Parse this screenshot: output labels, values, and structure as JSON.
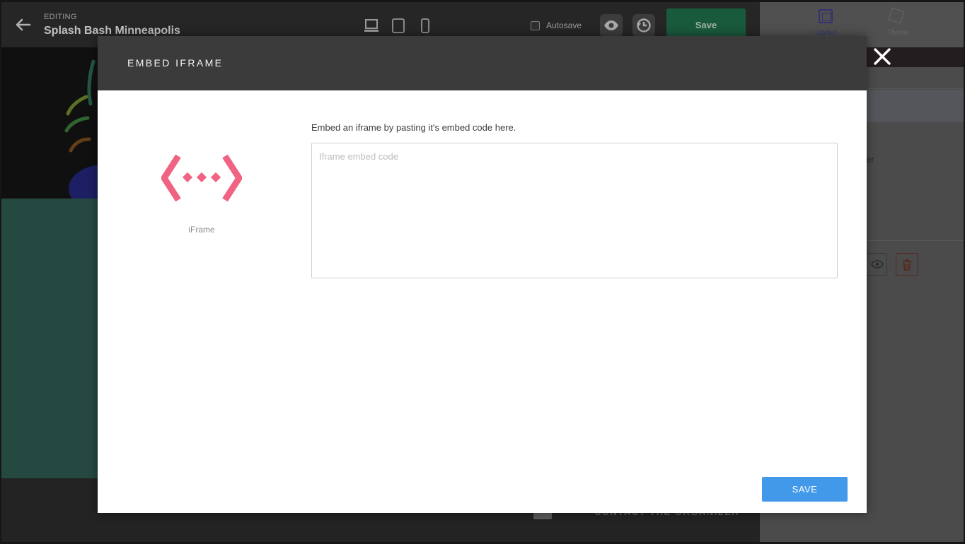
{
  "editor": {
    "editing_label": "EDITING",
    "event_title": "Splash Bash Minneapolis",
    "autosave_label": "Autosave",
    "autosave_checked": false,
    "save_label": "Save",
    "icons": {
      "back": "arrow-left-icon",
      "desktop": "desktop-icon",
      "tablet": "tablet-icon",
      "mobile": "mobile-icon",
      "preview": "eye-icon",
      "history": "history-icon"
    }
  },
  "page": {
    "contact_label": "CONTACT THE ORGANIZER"
  },
  "right_panel": {
    "tabs": [
      {
        "label": "Layout",
        "icon": "layout-icon",
        "active": true
      },
      {
        "label": "Theme",
        "icon": "theme-icon",
        "active": false
      }
    ],
    "partial_text": "er",
    "close_icon": "close-icon",
    "colors": {
      "active_tab": "#3d3f87"
    }
  },
  "modal": {
    "title": "EMBED IFRAME",
    "icon_name": "embed-code-icon",
    "icon_color": "#f06383",
    "caption": "iFrame",
    "instruction": "Embed an iframe by pasting it's embed code here.",
    "textarea": {
      "value": "",
      "placeholder": "Iframe embed code"
    },
    "save_label": "SAVE",
    "colors": {
      "header": "#3b3b3b",
      "save_button": "#4299ea"
    }
  }
}
